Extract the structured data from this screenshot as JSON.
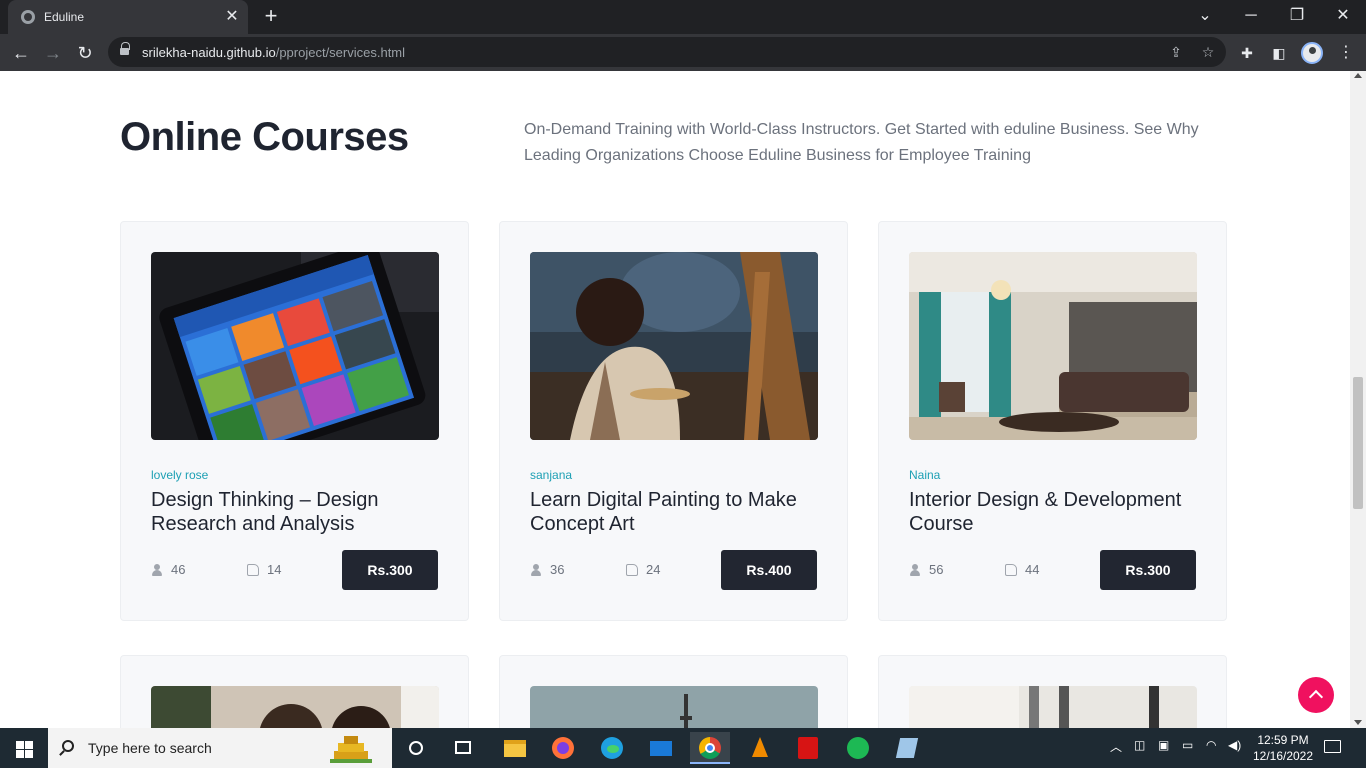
{
  "browser": {
    "tab_title": "Eduline",
    "url_host": "srilekha-naidu.github.io",
    "url_path": "/pproject/services.html"
  },
  "page": {
    "heading": "Online Courses",
    "description": "On-Demand Training with World-Class Instructors. Get Started with eduline Business. See Why Leading Organizations Choose Eduline Business for Employee Training",
    "courses": [
      {
        "author": "lovely rose",
        "title": "Design Thinking – Design Research and Analysis",
        "students": "46",
        "likes": "14",
        "price": "Rs.300"
      },
      {
        "author": "sanjana",
        "title": "Learn Digital Painting to Make Concept Art",
        "students": "36",
        "likes": "24",
        "price": "Rs.400"
      },
      {
        "author": "Naina",
        "title": "Interior Design & Development Course",
        "students": "56",
        "likes": "44",
        "price": "Rs.300"
      }
    ]
  },
  "taskbar": {
    "search_placeholder": "Type here to search",
    "time": "12:59 PM",
    "date": "12/16/2022"
  },
  "colors": {
    "accent": "#f0115f",
    "author": "#1ea0b4",
    "button": "#222631"
  }
}
